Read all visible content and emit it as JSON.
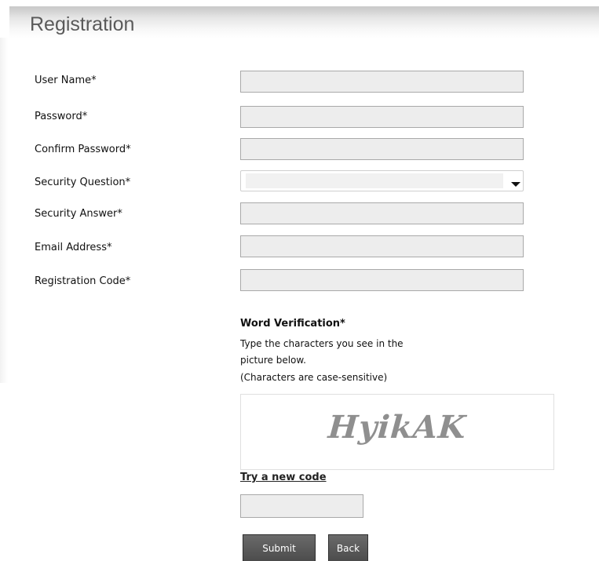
{
  "header": {
    "title": "Registration"
  },
  "form": {
    "fields": [
      {
        "label": "User Name*",
        "value": "",
        "placeholder": ""
      },
      {
        "label": "Password*",
        "value": "",
        "placeholder": ""
      },
      {
        "label": "Confirm Password*",
        "value": "",
        "placeholder": ""
      },
      {
        "label": "Security Question*",
        "selected": ""
      },
      {
        "label": "Security Answer*",
        "value": "",
        "placeholder": ""
      },
      {
        "label": "Email Address*",
        "value": "",
        "placeholder": ""
      },
      {
        "label": "Registration Code*",
        "value": "",
        "placeholder": ""
      }
    ]
  },
  "word_verification": {
    "title": "Word Verification*",
    "instruction_line1": "Type the characters you see in the",
    "instruction_line2": "picture below.",
    "note": "(Characters are case-sensitive)",
    "captcha_text": "HyikAK",
    "new_code_link": "Try a new code",
    "code_value": ""
  },
  "buttons": {
    "submit": "Submit",
    "back": "Back"
  },
  "colors": {
    "button_bg": "#555555",
    "input_bg": "#ededed",
    "captcha_text": "#8f8f8f"
  }
}
